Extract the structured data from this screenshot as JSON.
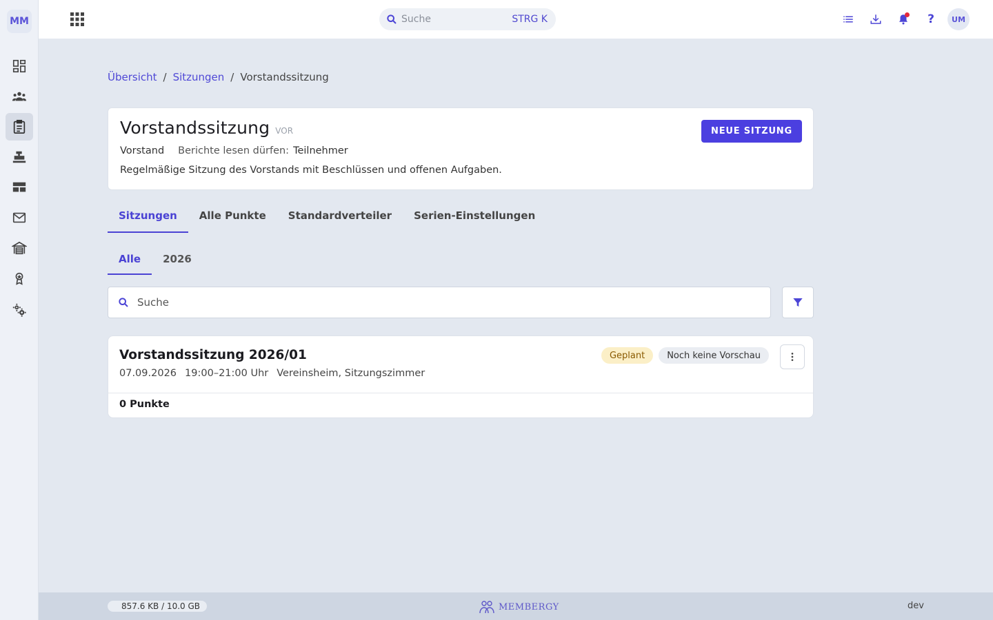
{
  "app": {
    "logo_text": "MM",
    "user_initials": "UM"
  },
  "sidebar": {
    "items": [
      {
        "name": "dashboard",
        "icon": "dashboard-icon",
        "active": false
      },
      {
        "name": "members",
        "icon": "people-icon",
        "active": false
      },
      {
        "name": "meetings",
        "icon": "clipboard-icon",
        "active": true
      },
      {
        "name": "cash",
        "icon": "cash-register-icon",
        "active": false
      },
      {
        "name": "layout",
        "icon": "table-layout-icon",
        "active": false
      },
      {
        "name": "mail",
        "icon": "mail-icon",
        "active": false
      },
      {
        "name": "facilities",
        "icon": "warehouse-icon",
        "active": false
      },
      {
        "name": "awards",
        "icon": "award-icon",
        "active": false
      },
      {
        "name": "settings",
        "icon": "gears-icon",
        "active": false
      }
    ]
  },
  "topbar": {
    "search_placeholder": "Suche",
    "search_shortcut": "STRG K",
    "help_label": "?"
  },
  "breadcrumb": {
    "items": [
      "Übersicht",
      "Sitzungen",
      "Vorstandssitzung"
    ],
    "separator": "/"
  },
  "header": {
    "title": "Vorstandssitzung",
    "abbreviation": "VOR",
    "group": "Vorstand",
    "read_permission_label": "Berichte lesen dürfen:",
    "read_permission_value": "Teilnehmer",
    "description": "Regelmäßige Sitzung des Vorstands mit Beschlüssen und offenen Aufgaben.",
    "new_button": "NEUE SITZUNG"
  },
  "tabs": [
    {
      "label": "Sitzungen",
      "active": true
    },
    {
      "label": "Alle Punkte",
      "active": false
    },
    {
      "label": "Standardverteiler",
      "active": false
    },
    {
      "label": "Serien-Einstellungen",
      "active": false
    }
  ],
  "subtabs": [
    {
      "label": "Alle",
      "active": true
    },
    {
      "label": "2026",
      "active": false
    }
  ],
  "list_search": {
    "placeholder": "Suche"
  },
  "sessions": [
    {
      "title": "Vorstandssitzung 2026/01",
      "date": "07.09.2026",
      "time": "19:00–21:00 Uhr",
      "location": "Vereinsheim, Sitzungszimmer",
      "status": "Geplant",
      "preview": "Noch keine Vorschau",
      "points": "0 Punkte"
    }
  ],
  "footer": {
    "storage": "857.6 KB / 10.0 GB",
    "brand": "MEMBERGY",
    "env": "dev"
  },
  "colors": {
    "accent": "#4b3fe0",
    "planned_bg": "#fbefc7",
    "notification": "#e5293b"
  }
}
